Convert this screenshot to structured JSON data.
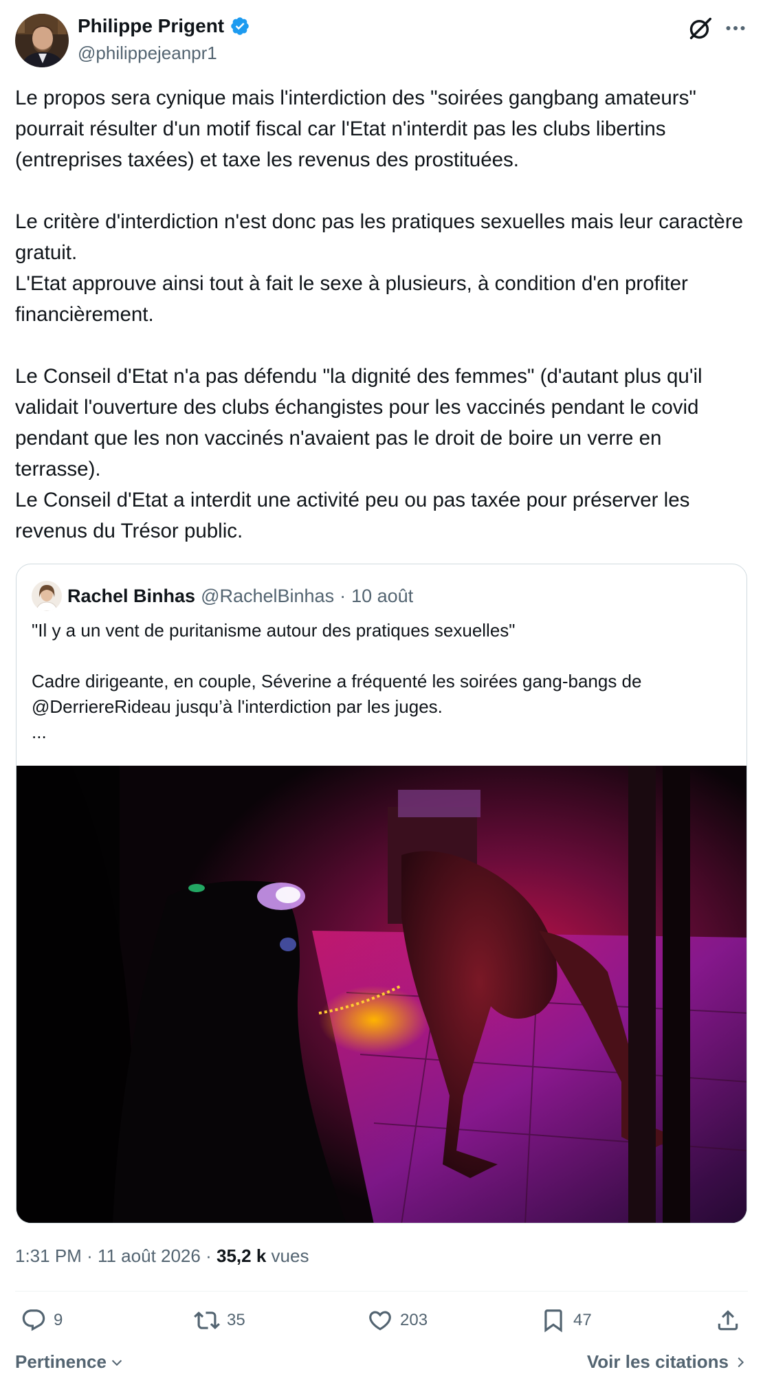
{
  "author": {
    "display_name": "Philippe Prigent",
    "handle": "@philippejeanpr1",
    "verified": true
  },
  "tweet": {
    "text": "Le propos sera cynique mais l'interdiction des \"soirées gangbang amateurs\" pourrait résulter d'un motif fiscal car l'Etat n'interdit pas les clubs libertins (entreprises taxées) et taxe les revenus des prostituées.\n\nLe critère d'interdiction n'est donc pas les pratiques sexuelles mais leur caractère gratuit.\nL'Etat approuve ainsi tout à fait le sexe à plusieurs, à condition d'en profiter financièrement.\n\nLe Conseil d'Etat n'a pas défendu \"la dignité des femmes\" (d'autant plus qu'il validait l'ouverture des clubs échangistes pour les vaccinés pendant le covid pendant que les non vaccinés n'avaient pas le droit de boire un verre en terrasse).\nLe Conseil d'Etat a interdit une activité peu ou pas taxée pour préserver les revenus du Trésor public."
  },
  "quote": {
    "display_name": "Rachel Binhas",
    "handle": "@RachelBinhas",
    "separator": "·",
    "date": "10 août",
    "text": "\"Il y a un vent de puritanisme autour des pratiques sexuelles\"\n\nCadre dirigeante, en couple, Séverine a fréquenté les soirées gang-bangs de @DerriereRideau jusqu’à l'interdiction par les juges.\n..."
  },
  "meta": {
    "time": "1:31 PM",
    "separator": "·",
    "date": "11 août 2026",
    "views_count": "35,2 k",
    "views_label": "vues"
  },
  "actions": {
    "replies": "9",
    "reposts": "35",
    "likes": "203",
    "bookmarks": "47"
  },
  "footer": {
    "sort_label": "Pertinence",
    "quotes_link": "Voir les citations"
  },
  "colors": {
    "text_primary": "#0f1419",
    "text_secondary": "#536471",
    "verified_blue": "#1d9bf0",
    "border": "#cfd9de"
  },
  "icons": [
    "verified-badge-icon",
    "grok-icon",
    "more-icon",
    "reply-icon",
    "repost-icon",
    "like-icon",
    "bookmark-icon",
    "share-icon",
    "chevron-down-icon",
    "chevron-right-icon"
  ]
}
